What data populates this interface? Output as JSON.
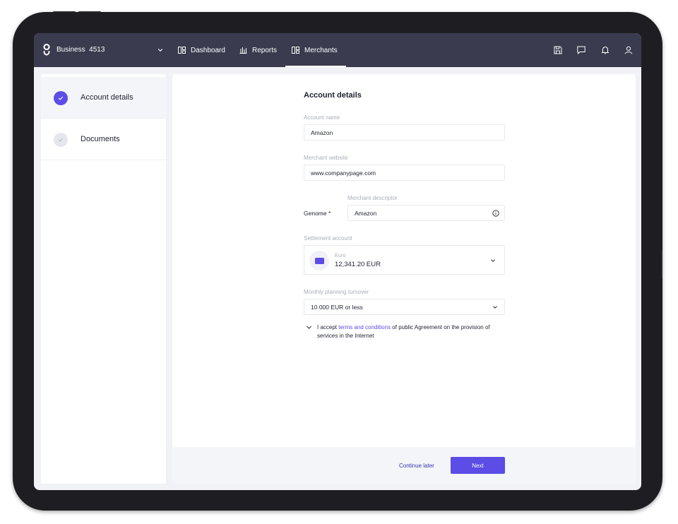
{
  "colors": {
    "accent": "#5b4de6",
    "topbar": "#3a3b4e",
    "device_frame": "#1e1e22"
  },
  "header": {
    "logo_icon": "genome-logo-icon",
    "business_label": "Business  4513",
    "nav": [
      {
        "label": "Dashboard",
        "icon": "dashboard-icon"
      },
      {
        "label": "Reports",
        "icon": "bar-chart-icon"
      },
      {
        "label": "Merchants",
        "icon": "merchants-icon",
        "active": true
      }
    ],
    "actions": [
      "save-icon",
      "chat-icon",
      "bell-icon",
      "user-icon"
    ]
  },
  "steps": [
    {
      "label": "Account details",
      "status": "current"
    },
    {
      "label": "Documents",
      "status": "pending"
    }
  ],
  "form": {
    "title": "Account details",
    "account_name": {
      "label": "Account name",
      "value": "Amazon"
    },
    "merchant_website": {
      "label": "Merchant website",
      "value": "www.companypage.com"
    },
    "genome_label": "Genome *",
    "merchant_descriptor": {
      "label": "Merchant descriptor",
      "value": "Amazon"
    },
    "settlement": {
      "label": "Settlement account",
      "currency": "Euro",
      "amount": "12,341.20 EUR"
    },
    "turnover": {
      "label": "Monthly planning turnover",
      "value": "10 000 EUR or less"
    },
    "accept": {
      "prefix": "I accept ",
      "link": "terms and conditions",
      "suffix": " of public Agreement on the provision of services in the Internet"
    }
  },
  "footer": {
    "continue_label": "Continue later",
    "next_label": "Next"
  }
}
